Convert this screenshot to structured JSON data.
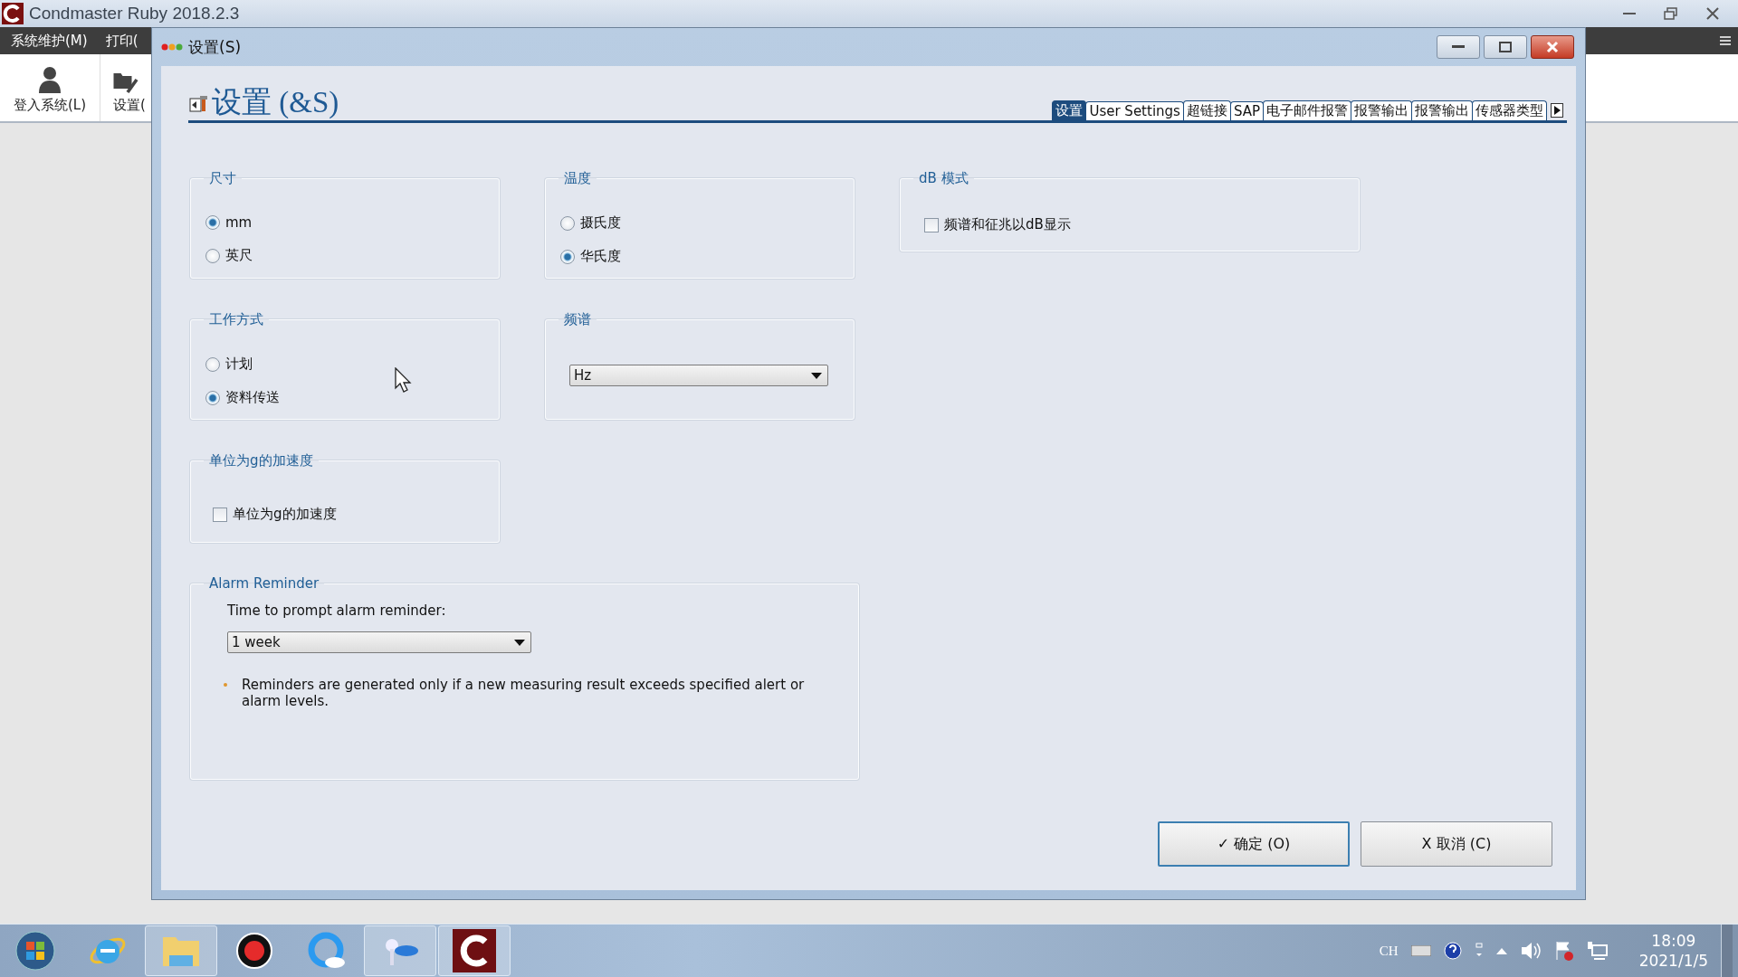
{
  "app_window": {
    "title": "Condmaster Ruby 2018.2.3"
  },
  "menu": [
    "系统维护(M)",
    "打印("
  ],
  "toolbar": [
    {
      "label": "登入系统(L)",
      "kind": "user"
    },
    {
      "label": "设置(",
      "kind": "tools"
    }
  ],
  "dialog": {
    "title": "设置(S)",
    "heading": "设置 (&S)",
    "tabs": [
      {
        "label": "设置",
        "selected": true
      },
      {
        "label": "User Settings",
        "selected": false
      },
      {
        "label": "超链接",
        "selected": false
      },
      {
        "label": "SAP",
        "selected": false
      },
      {
        "label": "电子邮件报警",
        "selected": false
      },
      {
        "label": "报警输出",
        "selected": false
      },
      {
        "label": "报警输出",
        "selected": false
      },
      {
        "label": "传感器类型",
        "selected": false
      }
    ],
    "groups": [
      {
        "title": "尺寸",
        "kind": "radio",
        "options": [
          {
            "label": "mm",
            "selected": true
          },
          {
            "label": "英尺",
            "selected": false
          }
        ]
      },
      {
        "title": "温度",
        "kind": "radio",
        "options": [
          {
            "label": "摄氏度",
            "selected": false
          },
          {
            "label": "华氏度",
            "selected": true
          }
        ]
      },
      {
        "title": "dB 模式",
        "kind": "checkbox",
        "label": "频谱和征兆以dB显示",
        "checked": false
      },
      {
        "title": "工作方式",
        "kind": "radio",
        "options": [
          {
            "label": "计划",
            "selected": false
          },
          {
            "label": "资料传送",
            "selected": true
          }
        ]
      },
      {
        "title": "频谱",
        "kind": "dropdown",
        "value": "Hz"
      },
      {
        "title": "单位为g的加速度",
        "kind": "checkbox",
        "label": "单位为g的加速度",
        "checked": false
      },
      {
        "title": "Alarm Reminder",
        "kind": "alarm",
        "prompt": "Time to prompt alarm reminder:",
        "value": "1 week",
        "note": "Reminders are generated only if a new measuring result exceeds specified alert or alarm levels."
      }
    ],
    "buttons": [
      {
        "label": "✓ 确定 (O)",
        "focused": true
      },
      {
        "label": "X 取消 (C)",
        "focused": false
      }
    ]
  },
  "tray": {
    "language": "CH",
    "time": "18:09",
    "date": "2021/1/5"
  }
}
